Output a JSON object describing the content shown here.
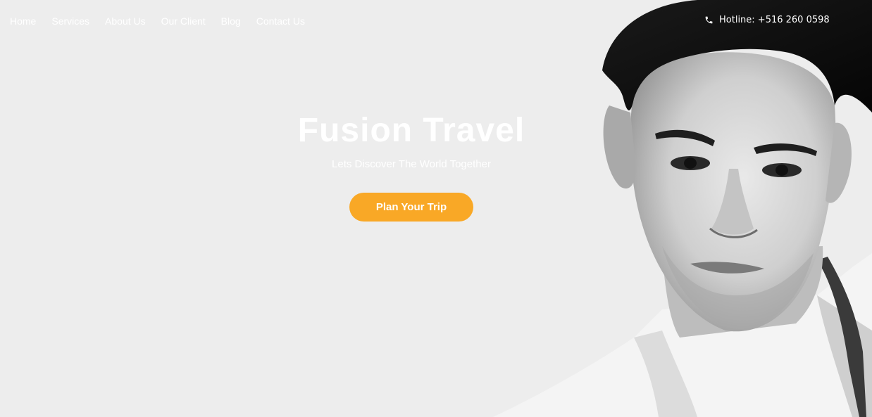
{
  "nav": {
    "items": [
      {
        "label": "Home"
      },
      {
        "label": "Services"
      },
      {
        "label": "About Us"
      },
      {
        "label": "Our Client"
      },
      {
        "label": "Blog"
      },
      {
        "label": "Contact Us"
      }
    ]
  },
  "hotline": {
    "text": "Hotline: +516 260 0598",
    "icon": "phone-icon"
  },
  "hero": {
    "title": "Fusion Travel",
    "subtitle": "Lets Discover The World Together",
    "cta_label": "Plan Your Trip"
  },
  "colors": {
    "background": "#ededed",
    "accent": "#f9a826",
    "text": "#ffffff"
  },
  "portrait": {
    "description_icon": "man-portrait-image"
  }
}
